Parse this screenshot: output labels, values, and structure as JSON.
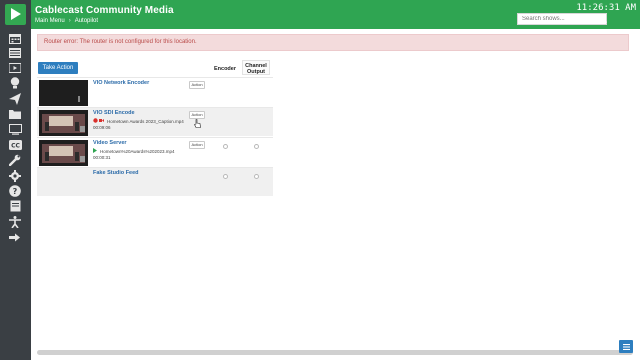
{
  "app": {
    "title": "Cablecast Community Media",
    "clock": "11:26:31 AM",
    "brand_color": "#2fa552"
  },
  "breadcrumb": {
    "items": [
      "Main Menu",
      "Autopilot"
    ],
    "separator": "›"
  },
  "search": {
    "placeholder": "Search shows..."
  },
  "sidebar": {
    "icons": [
      "calendar-icon",
      "list-icon",
      "video-icon",
      "lightbulb-icon",
      "send-icon",
      "folder-icon",
      "monitor-icon",
      "closed-caption-icon",
      "wrench-icon",
      "gear-icon",
      "question-icon",
      "book-icon",
      "accessibility-icon",
      "sign-out-icon"
    ]
  },
  "alert": {
    "text": "Router error: The router is not configured for this location."
  },
  "toolbar": {
    "take_action_label": "Take Action"
  },
  "table": {
    "headers": {
      "encoder": "Encoder",
      "channel_output": "Channel Output"
    },
    "rows": [
      {
        "name": "VIO Network Encoder",
        "action": "Action",
        "file": "",
        "time": "",
        "status": ""
      },
      {
        "name": "VIO SDI Encode",
        "action": "Action",
        "file": "Hometown Awards 2023_Caption.mp4",
        "time": "00:09:06",
        "status": "recording"
      },
      {
        "name": "Video Server",
        "action": "Action",
        "file": "Hometown%20Awards%202023.mp4",
        "time": "00:00:31",
        "status": "playing"
      },
      {
        "name": "Fake Studio Feed",
        "action": "",
        "file": "",
        "time": "",
        "status": ""
      }
    ]
  }
}
